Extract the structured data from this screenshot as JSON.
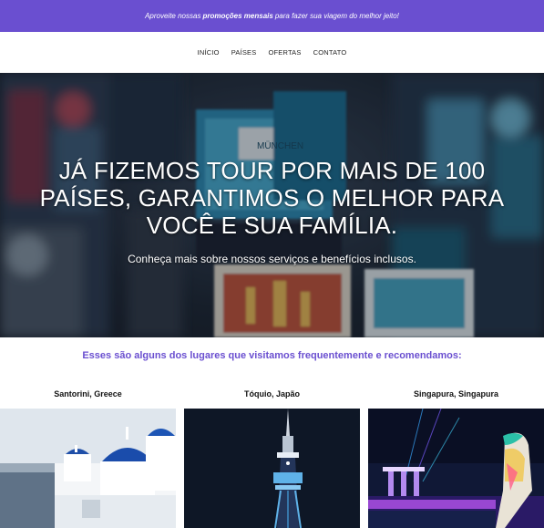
{
  "promo": {
    "text_before": "Aproveite nossas",
    "text_bold": "promoções mensais",
    "text_after": "para fazer sua viagem do melhor jeito!"
  },
  "nav": {
    "items": [
      {
        "label": "INÍCIO"
      },
      {
        "label": "PAÍSES"
      },
      {
        "label": "OFERTAS"
      },
      {
        "label": "CONTATO"
      }
    ]
  },
  "hero": {
    "title_line_1": "JÁ FIZEMOS TOUR POR MAIS DE 100",
    "title_line_2": "PAÍSES, GARANTIMOS O MELHOR PARA",
    "title_line_3": "VOCÊ E SUA FAMÍLIA.",
    "subtitle": "Conheça mais sobre nossos serviços e benefícios inclusos.",
    "postcard_text_top": "MÜNCHEN"
  },
  "places": {
    "heading": "Esses são alguns dos lugares que visitamos frequentemente e recomendamos:",
    "items": [
      {
        "name": "Santorini, Greece"
      },
      {
        "name": "Tóquio, Japão"
      },
      {
        "name": "Singapura, Singapura"
      }
    ]
  },
  "colors": {
    "brand": "#6a4fd0"
  }
}
